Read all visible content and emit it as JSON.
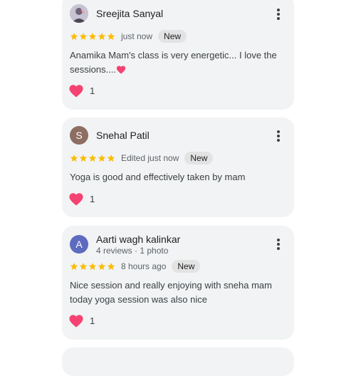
{
  "reviews": [
    {
      "name": "Sreejita Sanyal",
      "avatar_letter": "",
      "avatar_type": "photo",
      "meta": "",
      "rating": 5,
      "when": "just now",
      "badge": "New",
      "text": "Anamika Mam's class is very energetic... I love the sessions....",
      "text_emoji": "heart-emoji",
      "reaction_icon": "heart-icon",
      "reaction_count": "1"
    },
    {
      "name": "Snehal Patil",
      "avatar_letter": "S",
      "avatar_type": "letter",
      "meta": "",
      "rating": 5,
      "when": "Edited just now",
      "badge": "New",
      "text": "Yoga is good and effectively taken by mam",
      "reaction_icon": "heart-icon",
      "reaction_count": "1"
    },
    {
      "name": "Aarti wagh kalinkar",
      "avatar_letter": "A",
      "avatar_type": "letter",
      "meta": "4 reviews · 1 photo",
      "rating": 5,
      "when": "8 hours ago",
      "badge": "New",
      "text": "Nice session and really enjoying with sneha mam today yoga session was also nice",
      "reaction_icon": "heart-icon",
      "reaction_count": "1"
    }
  ],
  "colors": {
    "card_bg": "#f1f3f4",
    "star": "#fbbc04",
    "heart": "#f44372",
    "avatar_s": "#8d6e63",
    "avatar_a": "#5c6bc0"
  },
  "icons": {
    "menu": "more-vert-icon",
    "star": "star-icon"
  }
}
